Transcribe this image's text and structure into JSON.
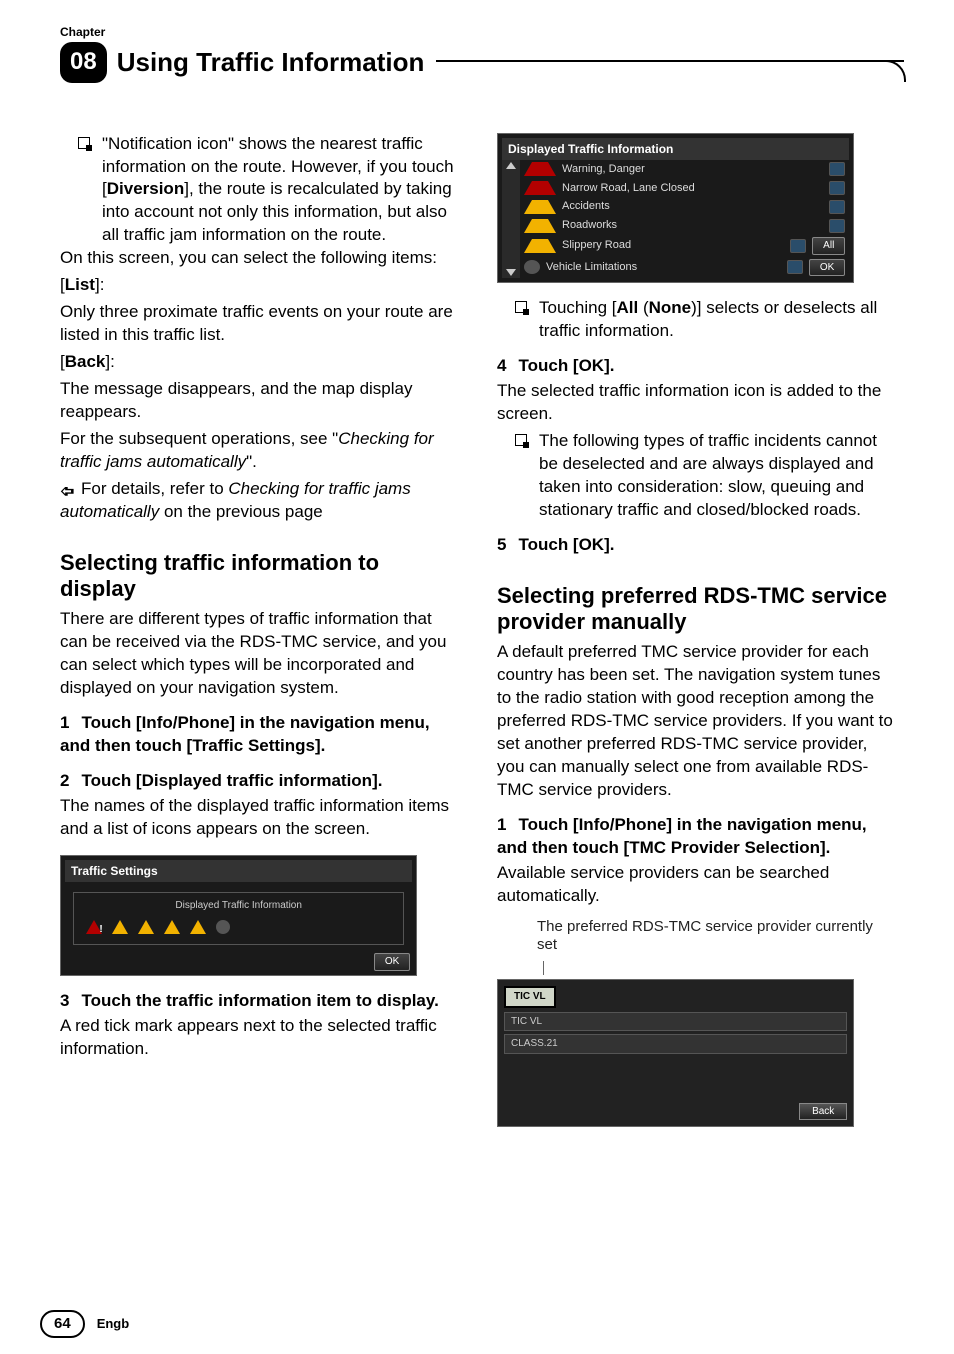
{
  "header": {
    "chapter_label": "Chapter",
    "chapter_number": "08",
    "chapter_title": "Using Traffic Information"
  },
  "col_left": {
    "bullet1": "\"Notification icon\" shows the nearest traffic information on the route. However, if you touch [",
    "bullet1_bold": "Diversion",
    "bullet1_cont": "], the route is recalculated by taking into account not only this information, but also all traffic jam information on the route.",
    "para1": "On this screen, you can select the following items:",
    "list_label": "List",
    "list_desc": "Only three proximate traffic events on your route are listed in this traffic list.",
    "back_label": "Back",
    "back_desc": "The message disappears, and the map display reappears.",
    "subsequent1": "For the subsequent operations, see \"",
    "subsequent_italic": "Checking for traffic jams automatically",
    "subsequent2": "\".",
    "ref1": "For details, refer to ",
    "ref_italic": "Checking for traffic jams automatically",
    "ref2": " on the previous page",
    "h2_select": "Selecting traffic information to display",
    "select_intro": "There are different types of traffic information that can be received via the RDS-TMC service, and you can select which types will be incorporated and displayed on your navigation system.",
    "step1": "Touch [Info/Phone] in the navigation menu, and then touch [Traffic Settings].",
    "step2": "Touch [Displayed traffic information].",
    "step2_desc": "The names of the displayed traffic information items and a list of icons appears on the screen.",
    "fig1_title": "Traffic Settings",
    "fig1_inner": "Displayed Traffic Information",
    "fig1_ok": "OK",
    "step3": "Touch the traffic information item to display.",
    "step3_desc": "A red tick mark appears next to the selected traffic information."
  },
  "col_right": {
    "fig2_title": "Displayed Traffic Information",
    "fig2_items": [
      "Warning, Danger",
      "Narrow Road, Lane Closed",
      "Accidents",
      "Roadworks",
      "Slippery Road",
      "Vehicle Limitations"
    ],
    "fig2_all": "All",
    "fig2_ok": "OK",
    "bullet2a": "Touching [",
    "bullet2_all": "All",
    "bullet2b": " (",
    "bullet2_none": "None",
    "bullet2c": ")] selects or deselects all traffic information.",
    "step4": "Touch [OK].",
    "step4_desc": "The selected traffic information icon is added to the screen.",
    "bullet3": "The following types of traffic incidents cannot be deselected and are always displayed and taken into consideration: slow, queuing and stationary traffic and closed/blocked roads.",
    "step5": "Touch [OK].",
    "h2_provider": "Selecting preferred RDS-TMC service provider manually",
    "provider_intro": "A default preferred TMC service provider for each country has been set. The navigation system tunes to the radio station with good reception among the preferred RDS-TMC service providers. If you want to set another preferred RDS-TMC service provider, you can manually select one from available RDS-TMC service providers.",
    "step1b": "Touch [Info/Phone] in the navigation menu, and then touch [TMC Provider Selection].",
    "step1b_desc": "Available service providers can be searched automatically.",
    "callout": "The preferred RDS-TMC service provider currently set",
    "fig3_tab": "TIC VL",
    "fig3_rows": [
      "TIC VL",
      "CLASS.21"
    ],
    "fig3_back": "Back"
  },
  "footer": {
    "page_number": "64",
    "lang": "Engb"
  }
}
